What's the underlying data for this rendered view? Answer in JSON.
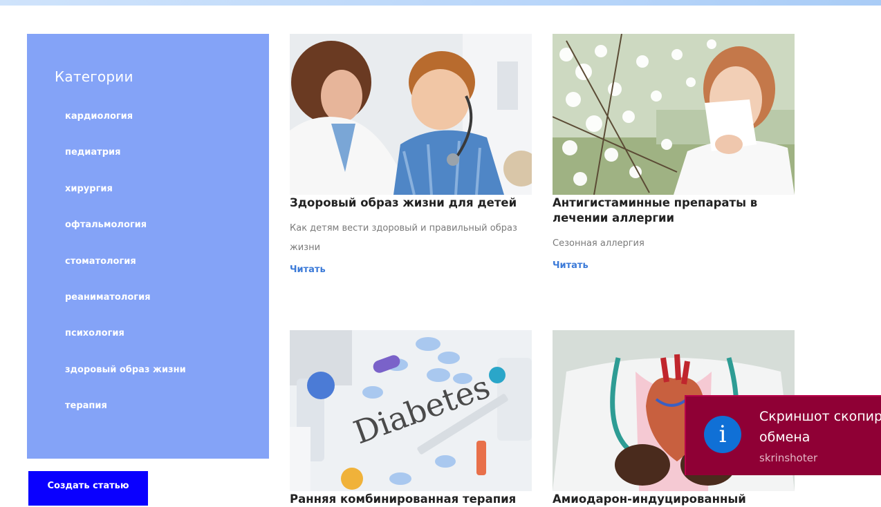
{
  "sidebar": {
    "title": "Категории",
    "items": [
      {
        "label": "кардиология"
      },
      {
        "label": "педиатрия"
      },
      {
        "label": "хирургия"
      },
      {
        "label": "офтальмология"
      },
      {
        "label": "стоматология"
      },
      {
        "label": "реаниматология"
      },
      {
        "label": "психология"
      },
      {
        "label": "здоровый образ жизни"
      },
      {
        "label": "терапия"
      }
    ],
    "create_button": "Создать статью"
  },
  "articles": [
    {
      "title": "Здоровый образ жизни для детей",
      "description": "Как детям вести здоровый и правильный образ жизни",
      "link": "Читать",
      "image": "doctor-with-child-photo"
    },
    {
      "title": "Антигистаминные препараты в лечении аллергии",
      "description": "Сезонная аллергия",
      "link": "Читать",
      "image": "woman-sneezing-blossom-photo"
    },
    {
      "title": "Ранняя комбинированная терапия",
      "image": "diabetes-pills-photo",
      "image_text": "Diabetes"
    },
    {
      "title": "Амиодарон-индуцированный",
      "image": "doctor-holding-heart-photo"
    }
  ],
  "toast": {
    "text_line1": "Скриншот скопир",
    "text_line2": "обмена",
    "app": "skrinshoter",
    "icon": "info-icon"
  },
  "colors": {
    "sidebar": "#84a3f7",
    "button": "#0a00ff",
    "link": "#3b7ad8",
    "toast": "#8f0035",
    "toast_icon": "#1070d6"
  }
}
